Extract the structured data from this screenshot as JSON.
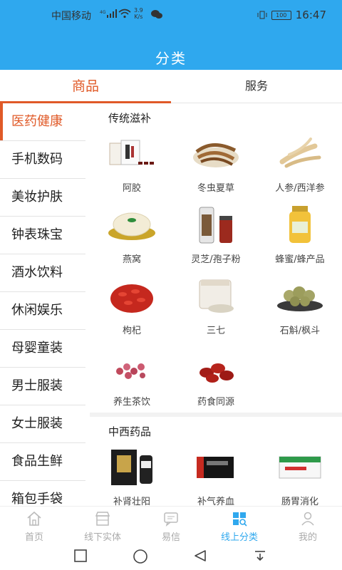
{
  "status": {
    "carrier": "中国移动",
    "net_tag": "4G",
    "speed_value": "3.9",
    "speed_unit": "K/s",
    "battery": "100",
    "time": "16:47"
  },
  "header": {
    "title": "分类"
  },
  "tabs": [
    {
      "label": "商品"
    },
    {
      "label": "服务"
    }
  ],
  "sidebar": {
    "items": [
      {
        "label": "医药健康"
      },
      {
        "label": "手机数码"
      },
      {
        "label": "美妆护肤"
      },
      {
        "label": "钟表珠宝"
      },
      {
        "label": "酒水饮料"
      },
      {
        "label": "休闲娱乐"
      },
      {
        "label": "母婴童装"
      },
      {
        "label": "男士服装"
      },
      {
        "label": "女士服装"
      },
      {
        "label": "食品生鲜"
      },
      {
        "label": "箱包手袋"
      }
    ]
  },
  "sections": [
    {
      "title": "传统滋补",
      "items": [
        {
          "label": "阿胶"
        },
        {
          "label": "冬虫夏草"
        },
        {
          "label": "人参/西洋参"
        },
        {
          "label": "燕窝"
        },
        {
          "label": "灵芝/孢子粉"
        },
        {
          "label": "蜂蜜/蜂产品"
        },
        {
          "label": "枸杞"
        },
        {
          "label": "三七"
        },
        {
          "label": "石斛/枫斗"
        },
        {
          "label": "养生茶饮"
        },
        {
          "label": "药食同源"
        }
      ]
    },
    {
      "title": "中西药品",
      "items": [
        {
          "label": "补肾壮阳"
        },
        {
          "label": "补气养血"
        },
        {
          "label": "肠胃消化"
        }
      ]
    }
  ],
  "bottom_nav": [
    {
      "label": "首页",
      "icon": "home-icon"
    },
    {
      "label": "线下实体",
      "icon": "store-icon"
    },
    {
      "label": "易信",
      "icon": "message-icon"
    },
    {
      "label": "线上分类",
      "icon": "category-icon"
    },
    {
      "label": "我的",
      "icon": "user-icon"
    }
  ],
  "colors": {
    "header": "#2fa8ee",
    "accent": "#e05a28",
    "nav_active": "#2fa8ee"
  }
}
